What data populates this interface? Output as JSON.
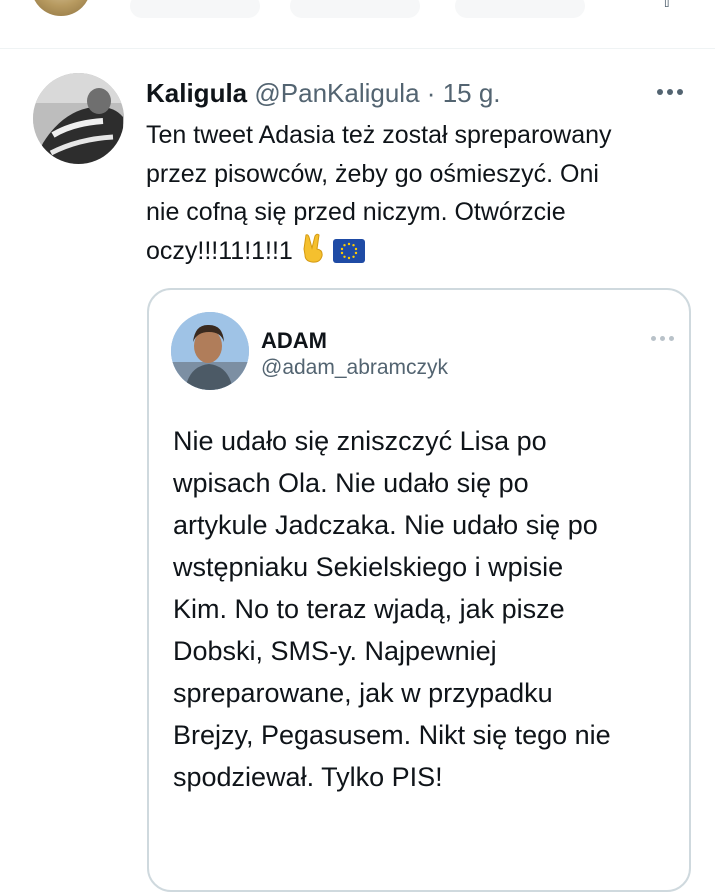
{
  "previous_tweet": {
    "icons": [
      "avatar",
      "share-icon"
    ]
  },
  "tweet": {
    "author_name": "Kaligula",
    "author_handle": "@PanKaligula",
    "separator": "·",
    "timestamp": "15 g.",
    "text_lines": [
      "Ten tweet Adasia też został spreparowany",
      "przez pisowców, żeby go ośmieszyć. Oni",
      "nie cofną się przed niczym. Otwórzcie",
      "oczy!!!11!1!!1"
    ],
    "emojis": [
      "victory-hand-emoji",
      "eu-flag-emoji"
    ],
    "more_icon": "more-horizontal-icon"
  },
  "quoted_tweet": {
    "author_name": "ADAM",
    "author_handle": "@adam_abramczyk",
    "text_lines": [
      "Nie udało się zniszczyć Lisa po",
      "wpisach Ola. Nie udało się po",
      "artykule Jadczaka. Nie udało się po",
      "wstępniaku Sekielskiego i wpisie",
      "Kim. No to teraz wjadą, jak pisze",
      "Dobski, SMS-y. Najpewniej",
      "spreparowane, jak w przypadku",
      "Brejzy, Pegasusem. Nikt się tego nie",
      "spodziewał. Tylko PIS!"
    ]
  },
  "colors": {
    "text_primary": "#0f1419",
    "text_secondary": "#536471",
    "border": "#cfd9de",
    "eu_blue": "#1f4ba5",
    "eu_star": "#ffcc00"
  }
}
